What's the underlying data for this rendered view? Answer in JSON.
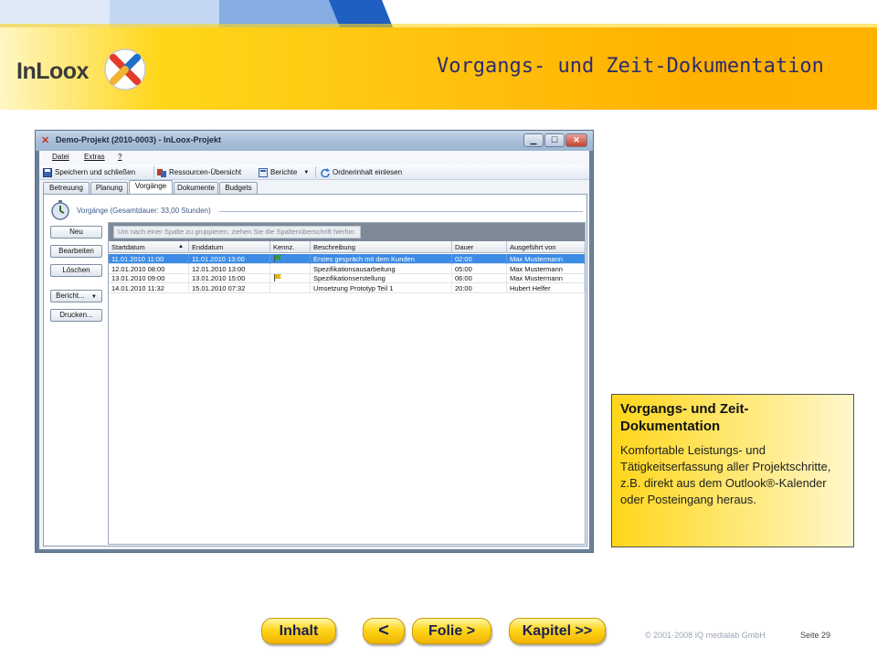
{
  "slide": {
    "title": "Vorgangs- und Zeit-Dokumentation",
    "logo_text": "InLoox"
  },
  "app": {
    "window_title": "Demo-Projekt (2010-0003) - InLoox-Projekt",
    "window_buttons": [
      "minimize",
      "maximize",
      "close"
    ],
    "menu": [
      "Datei",
      "Extras",
      "?"
    ],
    "toolbar": {
      "save": "Speichern und schließen",
      "resources": "Ressourcen-Übersicht",
      "reports": "Berichte",
      "folder": "Ordnerinhalt einlesen"
    },
    "tabs": [
      {
        "label": "Betreuung",
        "active": false
      },
      {
        "label": "Planung",
        "active": false
      },
      {
        "label": "Vorgänge",
        "active": true
      },
      {
        "label": "Dokumente",
        "active": false
      },
      {
        "label": "Budgets",
        "active": false
      }
    ],
    "section_title": "Vorgänge  (Gesamtdauer: 33,00 Stunden)",
    "side_buttons": {
      "neu": "Neu",
      "bearbeiten": "Bearbeiten",
      "loeschen": "Löschen",
      "bericht": "Bericht...",
      "drucken": "Drucken..."
    },
    "group_hint": "Um nach einer Spalte zu gruppieren, ziehen Sie die Spaltenüberschrift hierhin.",
    "columns": [
      "Startdatum",
      "Enddatum",
      "Kennz.",
      "Beschreibung",
      "Dauer",
      "Ausgeführt von"
    ],
    "rows": [
      {
        "start": "11.01.2010 11:00",
        "end": "11.01.2010 13:00",
        "flag": "green",
        "desc": "Erstes gespräch mit dem Kunden",
        "duration": "02:00",
        "by": "Max Mustermann",
        "selected": true
      },
      {
        "start": "12.01.2010 08:00",
        "end": "12.01.2010 13:00",
        "flag": "",
        "desc": "Spezifikationsausarbeitung",
        "duration": "05:00",
        "by": "Max Mustermann",
        "selected": false
      },
      {
        "start": "13.01.2010 09:00",
        "end": "13.01.2010 15:00",
        "flag": "yellow",
        "desc": "Spezifikationserstellung",
        "duration": "06:00",
        "by": "Max Mustermann",
        "selected": false
      },
      {
        "start": "14.01.2010 11:32",
        "end": "15.01.2010 07:32",
        "flag": "",
        "desc": "Umsetzung Prototyp Teil 1",
        "duration": "20:00",
        "by": "Hubert Helfer",
        "selected": false
      }
    ]
  },
  "desc_box": {
    "title": "Vorgangs- und Zeit-Dokumentation",
    "body": "Komfortable Leistungs- und Tätigkeitserfassung aller Projektschritte, z.B. direkt aus dem Outlook®-Kalender oder Posteingang heraus."
  },
  "nav": {
    "inhalt": "Inhalt",
    "prev": "<",
    "folie": "Folie >",
    "kapitel": "Kapitel >>"
  },
  "footer": {
    "copyright": "© 2001-2008 IQ medialab GmbH",
    "page": "Seite 29"
  },
  "colors": {
    "accent_yellow": "#ffc20e",
    "title_blue": "#2c2c6e",
    "selection_blue": "#3c8ce6"
  }
}
